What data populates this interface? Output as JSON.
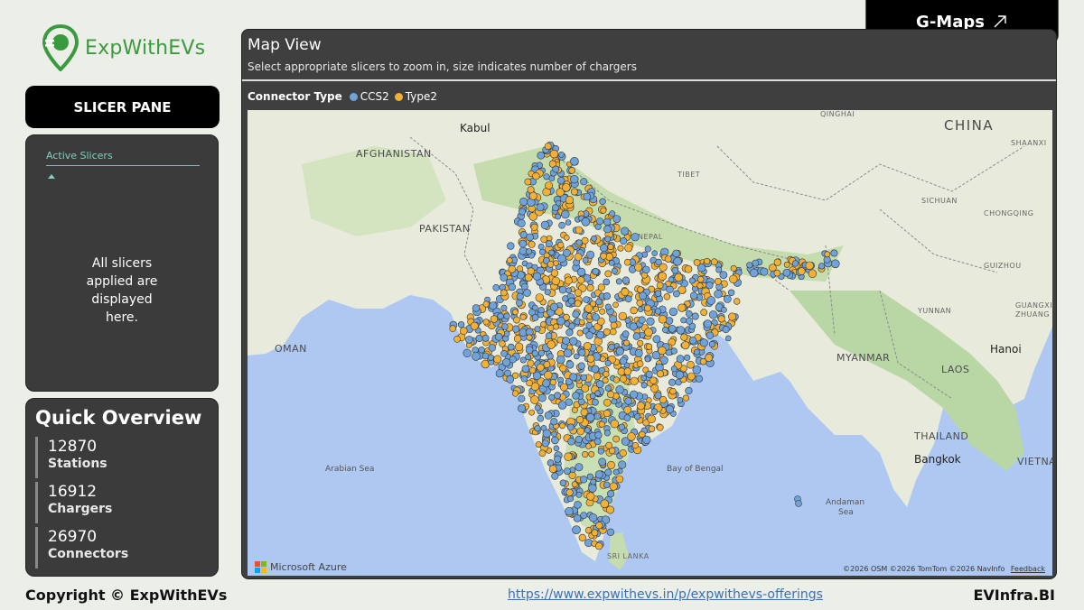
{
  "brand": {
    "logo_text": "ExpWithEVs",
    "colors": {
      "primary_green": "#3a9a3e",
      "panel_dark": "#3b3b3b",
      "button_black": "#000000"
    }
  },
  "header": {
    "gmaps_label": "G-Maps",
    "gmaps_icon": "external-arrow-icon"
  },
  "sidebar": {
    "slicer_pane_label": "SLICER PANE",
    "active_slicers_tab": "Active Slicers",
    "active_slicers_message": "All slicers applied are displayed here."
  },
  "quick_overview": {
    "title": "Quick Overview",
    "kpis": [
      {
        "value": "12870",
        "label": "Stations"
      },
      {
        "value": "16912",
        "label": "Chargers"
      },
      {
        "value": "26970",
        "label": "Connectors"
      }
    ]
  },
  "map": {
    "title": "Map View",
    "subtitle": "Select appropriate slicers to zoom in, size indicates number of chargers",
    "legend_title": "Connector Type",
    "legend": [
      {
        "name": "CCS2",
        "color": "#6fa3d9"
      },
      {
        "name": "Type2",
        "color": "#f2b136"
      }
    ],
    "labels": {
      "kabul": "Kabul",
      "afghanistan": "AFGHANISTAN",
      "pakistan": "PAKISTAN",
      "nepal": "NEPAL",
      "tibet": "TIBET",
      "china": "CHINA",
      "qinghai": "QINGHAI",
      "shaanxi": "SHAANXI",
      "sichuan": "SICHUAN",
      "chongqing": "CHONGQING",
      "guizhou": "GUIZHOU",
      "yunnan": "YUNNAN",
      "guangxi": "GUANGXI",
      "zhuang": "ZHUANG",
      "oman": "OMAN",
      "myanmar": "MYANMAR",
      "laos": "LAOS",
      "thailand": "THAILAND",
      "hanoi": "Hanoi",
      "bangkok": "Bangkok",
      "vietnam": "VIETNA",
      "arabian_sea": "Arabian Sea",
      "bay_of_bengal": "Bay of Bengal",
      "andaman": "Andaman",
      "andaman_sea": "Sea",
      "sri_lanka": "SRI LANKA"
    },
    "provider": "Microsoft Azure",
    "attribution": "©2026 OSM  ©2026 TomTom  ©2026 NavInfo",
    "feedback": "Feedback"
  },
  "footer": {
    "copyright": "Copyright © ExpWithEVs",
    "link": "https://www.expwithevs.in/p/expwithevs-offerings",
    "brand_right": "EVInfra.BI"
  }
}
